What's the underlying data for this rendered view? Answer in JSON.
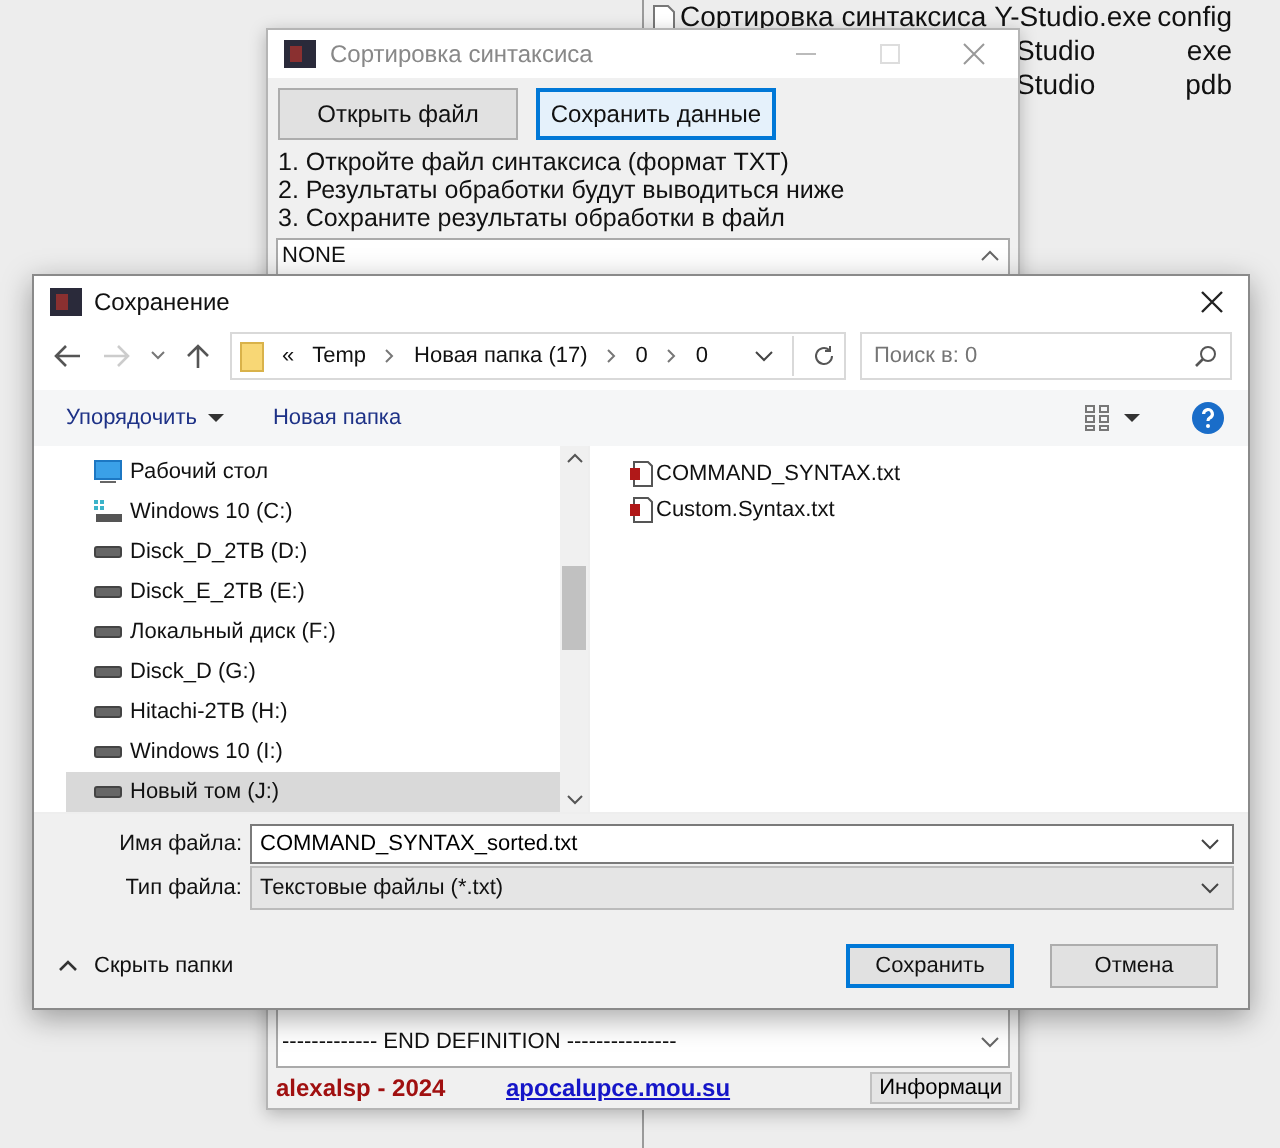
{
  "desktop": {
    "files": [
      {
        "name": "Сортировка синтаксиса Y-Studio.exe",
        "type": "config",
        "kind": "full"
      },
      {
        "name": "Studio",
        "type": "exe",
        "kind": "partial"
      },
      {
        "name": "Studio",
        "type": "pdb",
        "kind": "partial"
      }
    ]
  },
  "app_window": {
    "title": "Сортировка синтаксиса",
    "buttons": [
      {
        "label": "Открыть файл",
        "focused": false
      },
      {
        "label": "Сохранить данные",
        "focused": true
      }
    ],
    "instructions": [
      "1. Откройте файл синтаксиса (формат TXT)",
      "2. Результаты обработки будут выводиться ниже",
      "3. Сохраните результаты обработки в файл"
    ],
    "output_top": "NONE",
    "output_bottom": "------------- END DEFINITION ---------------",
    "author": "alexalsp - 2024",
    "link": "apocalupce.mou.su",
    "info_button": "Информаци"
  },
  "save_dialog": {
    "title": "Сохранение",
    "overflow": "«",
    "breadcrumb": [
      "Temp",
      "Новая папка (17)",
      "0",
      "0"
    ],
    "search": {
      "placeholder": "Поиск в: 0"
    },
    "toolbar": {
      "organize": "Упорядочить",
      "new_folder": "Новая папка"
    },
    "nav_items": [
      {
        "label": "Рабочий стол",
        "kind": "desktop",
        "selected": false
      },
      {
        "label": "Windows 10 (C:)",
        "kind": "system",
        "selected": false
      },
      {
        "label": "Disck_D_2TB (D:)",
        "kind": "drive",
        "selected": false
      },
      {
        "label": "Disck_E_2TB (E:)",
        "kind": "drive",
        "selected": false
      },
      {
        "label": "Локальный диск (F:)",
        "kind": "drive",
        "selected": false
      },
      {
        "label": "Disck_D (G:)",
        "kind": "drive",
        "selected": false
      },
      {
        "label": "Hitachi-2TB (H:)",
        "kind": "drive",
        "selected": false
      },
      {
        "label": "Windows 10 (I:)",
        "kind": "drive",
        "selected": false
      },
      {
        "label": "Новый том (J:)",
        "kind": "drive",
        "selected": true
      }
    ],
    "files": [
      "COMMAND_SYNTAX.txt",
      "Custom.Syntax.txt"
    ],
    "file_name": {
      "label": "Имя файла:",
      "value": "COMMAND_SYNTAX_sorted.txt"
    },
    "file_type": {
      "label": "Тип файла:",
      "value": "Текстовые файлы (*.txt)"
    },
    "hide_folders": "Скрыть папки",
    "buttons": [
      {
        "label": "Сохранить",
        "default": true
      },
      {
        "label": "Отмена",
        "default": false
      }
    ]
  }
}
